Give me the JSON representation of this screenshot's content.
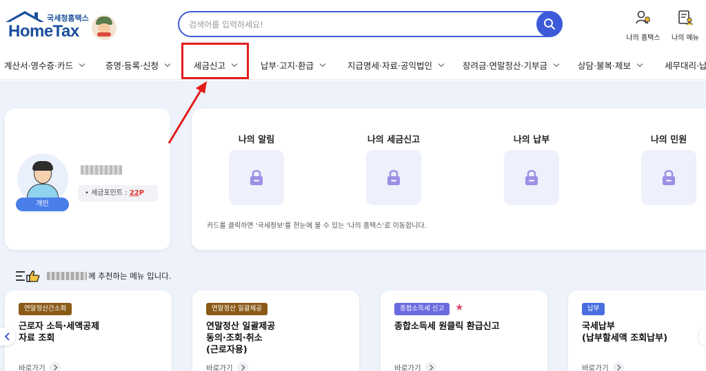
{
  "brand": {
    "sub": "국세청홈택스",
    "name": "HomeTax"
  },
  "search": {
    "placeholder": "검색어를 입력하세요!"
  },
  "utility": {
    "my_hometax": "나의 홈택스",
    "my_menu": "나의 메뉴"
  },
  "nav": {
    "items": [
      {
        "label": "계산서·영수증·카드"
      },
      {
        "label": "증명·등록·신청"
      },
      {
        "label": "세금신고"
      },
      {
        "label": "납부·고지·환급"
      },
      {
        "label": "지급명세·자료·공익법인"
      },
      {
        "label": "장려금·연말정산·기부금"
      },
      {
        "label": "상담·불복·제보"
      },
      {
        "label": "세무대리·납세"
      }
    ]
  },
  "profile": {
    "user_type": "개인",
    "points_label": "세금포인트 : ",
    "points_value": "22",
    "points_unit": "P"
  },
  "status": {
    "items": [
      {
        "title": "나의 알림"
      },
      {
        "title": "나의 세금신고"
      },
      {
        "title": "나의 납부"
      },
      {
        "title": "나의 민원"
      }
    ],
    "note": "카드를 클릭하면 '국세정보'를 한눈에 볼 수 있는 '나의 홈택스'로 이동합니다."
  },
  "recommend": {
    "suffix": "께 추천하는 메뉴 입니다."
  },
  "cards": [
    {
      "tag": "연말정산간소화",
      "tag_color": "#8a5a17",
      "title": "근로자 소득·세액공제\n자료 조회",
      "go": "바로가기"
    },
    {
      "tag": "연말정산 일괄제공",
      "tag_color": "#8a5a17",
      "title": "연말정산 일괄제공\n동의·조회·취소\n(근로자용)",
      "go": "바로가기"
    },
    {
      "tag": "종합소득세 신고",
      "tag_color": "#6a6ae0",
      "title": "종합소득세 원클릭 환급신고",
      "go": "바로가기"
    },
    {
      "tag": "납부",
      "tag_color": "#4a6ee0",
      "title": "국세납부\n(납부할세액 조회납부)",
      "go": "바로가기"
    }
  ],
  "colors": {
    "brand": "#1b4f9c",
    "accent": "#3d5bd8",
    "highlight": "#e21b1b",
    "page_bg": "#eef2fa"
  }
}
